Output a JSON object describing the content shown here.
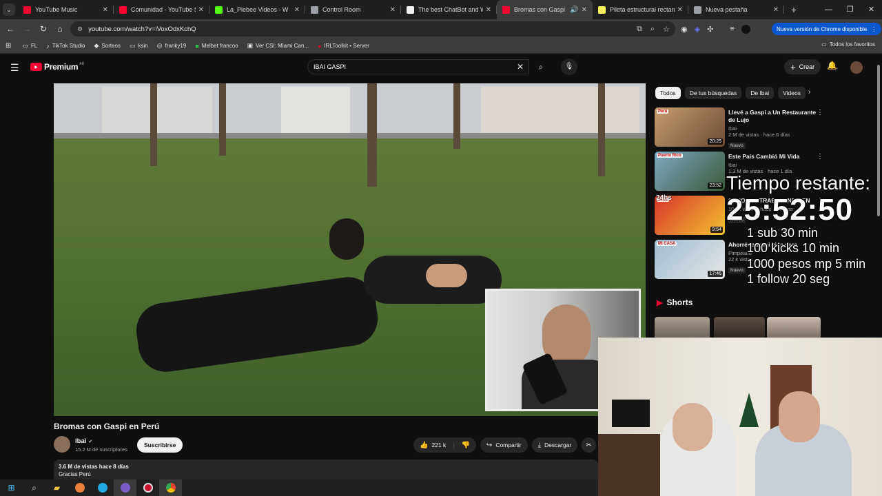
{
  "browser": {
    "tabs": [
      {
        "title": "YouTube Music",
        "color": "#ff0033",
        "active": false
      },
      {
        "title": "Comunidad - YouTube Studio",
        "color": "#ff0033",
        "active": false
      },
      {
        "title": "La_Plebee Videos - W",
        "color": "#53fc18",
        "active": false
      },
      {
        "title": "Control Room",
        "color": "#9aa0a6",
        "active": false
      },
      {
        "title": "The best ChatBot and Wi",
        "color": "#f1f1f1",
        "active": false
      },
      {
        "title": "Bromas con Gaspi en",
        "color": "#ff0033",
        "active": true
      },
      {
        "title": "Pileta estructural rectang",
        "color": "#fff159",
        "active": false
      },
      {
        "title": "Nueva pestaña",
        "color": "#9aa0a6",
        "active": false
      }
    ],
    "url": "youtube.com/watch?v=iVoxOdxKchQ",
    "update_label": "Nueva versión de Chrome disponible",
    "bookmarks": [
      {
        "label": "FL",
        "icon": "folder-icon"
      },
      {
        "label": "TikTok Studio",
        "icon": "tiktok-icon"
      },
      {
        "label": "Sorteos",
        "icon": "diamond-icon"
      },
      {
        "label": "ksin",
        "icon": "folder-icon"
      },
      {
        "label": "franky19",
        "icon": "twitch-icon"
      },
      {
        "label": "Melbet francoo",
        "icon": "melbet-icon"
      },
      {
        "label": "Ver CSI: Miami Can...",
        "icon": "tv-icon"
      },
      {
        "label": "IRLToolkit • Server",
        "icon": "irl-icon"
      }
    ],
    "all_bookmarks": "Todos los favoritos"
  },
  "youtube": {
    "brand": "Premium",
    "country": "AR",
    "search_value": "IBAI GASPI",
    "create_label": "Crear",
    "video": {
      "title": "Bromas con Gaspi en Perú",
      "channel": "Ibai",
      "subscribers": "15.2 M de suscriptores",
      "subscribe_label": "Suscribirse",
      "likes": "221 k",
      "share_label": "Compartir",
      "download_label": "Descargar",
      "views_date": "3.6 M de vistas  hace 8 días",
      "description_start": "Gracias Perú"
    },
    "chips": [
      "Todos",
      "De tus búsquedas",
      "De Ibai",
      "Videos"
    ],
    "recommendations": [
      {
        "title": "Llevé a Gaspi a Un Restaurante de Lujo",
        "channel": "Ibai",
        "stats": "2 M de vistas · hace 6 días",
        "badge": "Nuevo",
        "duration": "20:25",
        "thumb_tag": "Perú"
      },
      {
        "title": "Este País Cambió Mi Vida",
        "channel": "Ibai",
        "stats": "1,3 M de vistas · hace 1 día",
        "badge": "",
        "duration": "23:52",
        "thumb_tag": "Puerto Rico"
      },
      {
        "title": "24 HORAS TRABAJANDO EN",
        "channel": "",
        "stats": "106 k vistas · hace 20 horas",
        "badge": "Nuevo",
        "duration": "9:54",
        "thumb_tag": "24hs"
      },
      {
        "title": "Ahorré toda mi vida para",
        "channel": "Pimpeano",
        "stats": "22 k vistas",
        "badge": "Nuevo",
        "duration": "17:46",
        "thumb_tag": "MI CASA"
      }
    ],
    "shorts_label": "Shorts"
  },
  "overlay": {
    "title": "Tiempo restante:",
    "time": "25:52:50",
    "rules": [
      "1 sub 30 min",
      "100 kicks 10 min",
      "1000 pesos mp 5 min",
      "1 follow 20 seg"
    ]
  }
}
